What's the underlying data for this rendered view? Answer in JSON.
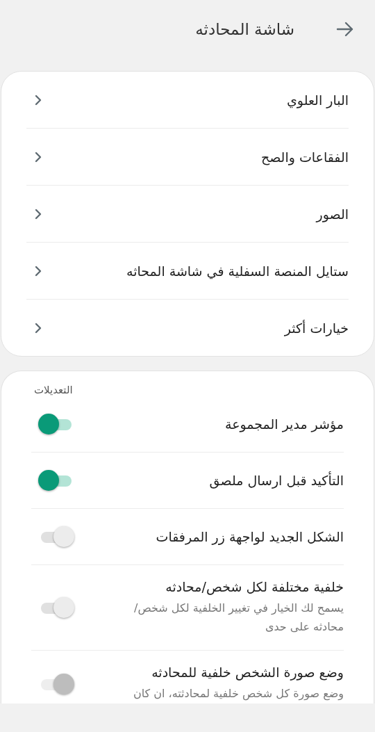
{
  "header": {
    "title": "شاشة المحادثه"
  },
  "menu": [
    {
      "label": "البار العلوي"
    },
    {
      "label": "الفقاعات والصح"
    },
    {
      "label": "الصور"
    },
    {
      "label": "ستايل المنصة السفلية في شاشة المحاثه"
    },
    {
      "label": "خيارات أكثر"
    }
  ],
  "settings": {
    "section_title": "التعديلات",
    "toggles": [
      {
        "label": "مؤشر مدير المجموعة",
        "on": true,
        "disabled": false
      },
      {
        "label": "التأكيد قبل ارسال ملصق",
        "on": true,
        "disabled": false
      },
      {
        "label": "الشكل الجديد لواجهة زر المرفقات",
        "on": false,
        "disabled": false
      },
      {
        "label": "خلفية مختلفة لكل شخص/محادثه",
        "description": "يسمح لك الخيار في تغيير الخلفية لكل شخص/ محادثه على حدى",
        "on": false,
        "disabled": false
      },
      {
        "label": "وضع صورة الشخص خلفية للمحادثه",
        "description": "وضع صورة كل شخص خلفية لمحادثته، ان كان",
        "on": false,
        "disabled": true
      }
    ]
  }
}
